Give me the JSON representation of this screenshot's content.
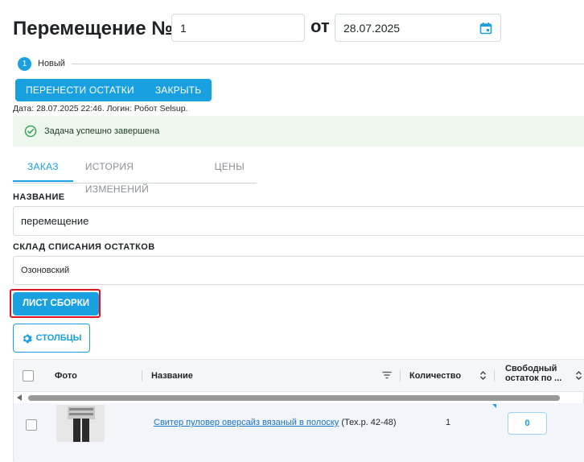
{
  "header": {
    "title": "Перемещение №",
    "number_value": "1",
    "from_label": "от",
    "date_value": "28.07.2025"
  },
  "status": {
    "step_number": "1",
    "step_label": "Новый"
  },
  "actions": {
    "transfer_label": "ПЕРЕНЕСТИ ОСТАТКИ",
    "close_label": "ЗАКРЫТЬ"
  },
  "meta": {
    "text": "Дата: 28.07.2025 22:46. Логин: Робот Selsup."
  },
  "alert": {
    "message": "Задача успешно завершена"
  },
  "tabs": [
    {
      "label": "ЗАКАЗ",
      "active": true
    },
    {
      "label": "ИСТОРИЯ ИЗМЕНЕНИЙ",
      "active": false
    },
    {
      "label": "ЦЕНЫ",
      "active": false
    }
  ],
  "form": {
    "name_label": "НАЗВАНИЕ",
    "name_value": "перемещение",
    "warehouse_label": "СКЛАД СПИСАНИЯ ОСТАТКОВ",
    "warehouse_value": "Озоновский"
  },
  "buttons": {
    "picking_sheet": "ЛИСТ СБОРКИ",
    "columns": "СТОЛБЦЫ"
  },
  "table": {
    "headers": {
      "photo": "Фото",
      "name": "Название",
      "quantity": "Количество",
      "free_stock_line1": "Свободный",
      "free_stock_line2": "остаток по ..."
    },
    "rows": [
      {
        "name_link": "Свитер пуловер оверсайз вязаный в полоску",
        "name_suffix": " (Тех.р. 42-48)",
        "quantity": "1",
        "free_stock": "0"
      }
    ]
  },
  "colors": {
    "accent": "#18a0e0",
    "success_bg": "#edf7ee",
    "highlight": "#e0141e"
  }
}
